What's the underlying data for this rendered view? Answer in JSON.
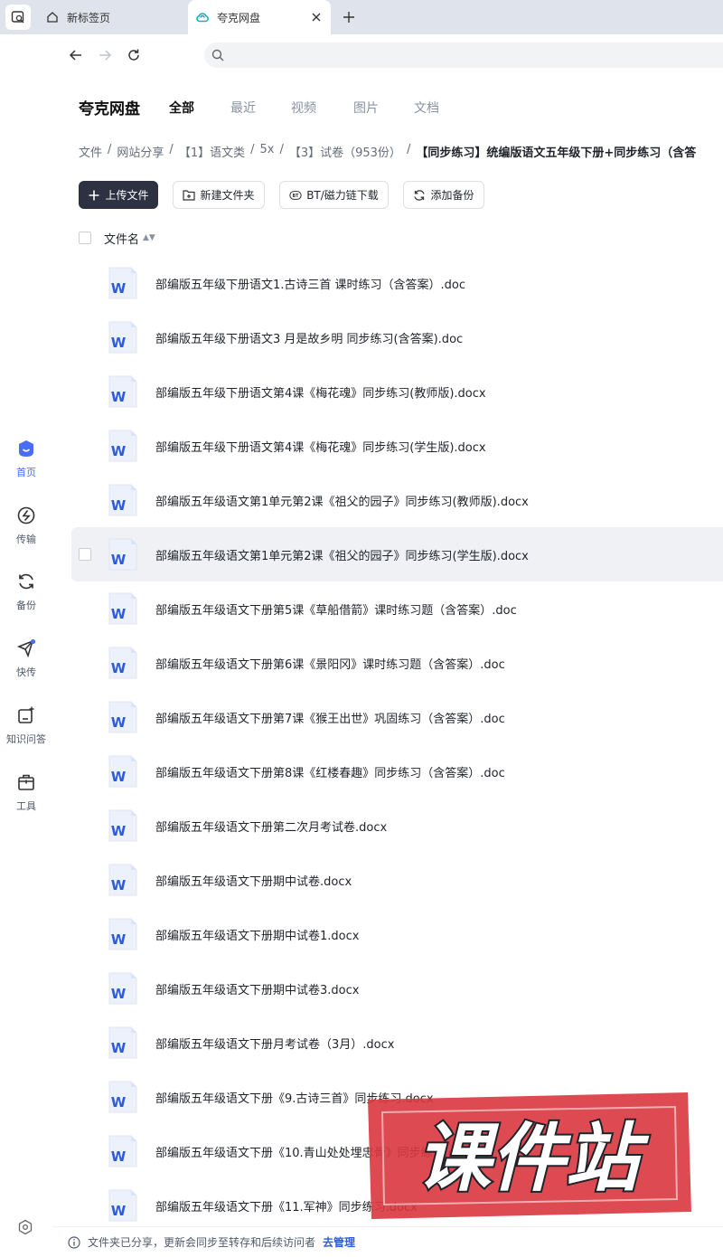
{
  "browser": {
    "tabs": [
      {
        "title": "新标签页"
      },
      {
        "title": "夸克网盘"
      }
    ],
    "address": {
      "value": "",
      "placeholder": ""
    }
  },
  "sidebar": {
    "items": [
      {
        "label": "首页",
        "icon": "home-robot-icon"
      },
      {
        "label": "传输",
        "icon": "transfer-icon"
      },
      {
        "label": "备份",
        "icon": "backup-sync-icon"
      },
      {
        "label": "快传",
        "icon": "paper-plane-icon"
      },
      {
        "label": "知识问答",
        "icon": "knowledge-qa-icon"
      },
      {
        "label": "工具",
        "icon": "toolbox-icon"
      }
    ]
  },
  "header": {
    "brand": "夸克网盘",
    "tabs": [
      "全部",
      "最近",
      "视频",
      "图片",
      "文档"
    ]
  },
  "breadcrumb": [
    "文件",
    "网站分享",
    "【1】语文类",
    "5x",
    "【3】试卷（953份）",
    "【同步练习】统编版语文五年级下册+同步练习（含答"
  ],
  "actions": {
    "upload": "上传文件",
    "new_folder": "新建文件夹",
    "bt_download": "BT/磁力链下载",
    "add_backup": "添加备份"
  },
  "list": {
    "header": "文件名",
    "files": [
      "部编版五年级下册语文1.古诗三首 课时练习（含答案）.doc",
      "部编版五年级下册语文3 月是故乡明 同步练习(含答案).doc",
      "部编版五年级下册语文第4课《梅花魂》同步练习(教师版).docx",
      "部编版五年级下册语文第4课《梅花魂》同步练习(学生版).docx",
      "部编版五年级语文第1单元第2课《祖父的园子》同步练习(教师版).docx",
      "部编版五年级语文第1单元第2课《祖父的园子》同步练习(学生版).docx",
      "部编版五年级语文下册第5课《草船借箭》课时练习题（含答案）.doc",
      "部编版五年级语文下册第6课《景阳冈》课时练习题（含答案）.doc",
      "部编版五年级语文下册第7课《猴王出世》巩固练习（含答案）.doc",
      "部编版五年级语文下册第8课《红楼春趣》同步练习（含答案）.doc",
      "部编版五年级语文下册第二次月考试卷.docx",
      "部编版五年级语文下册期中试卷.docx",
      "部编版五年级语文下册期中试卷1.docx",
      "部编版五年级语文下册期中试卷3.docx",
      "部编版五年级语文下册月考试卷（3月）.docx",
      "部编版五年级语文下册《9.古诗三首》同步练习.docx",
      "部编版五年级语文下册《10.青山处处埋忠骨》同步练习.docx",
      "部编版五年级语文下册《11.军神》同步练习.docx"
    ]
  },
  "footer": {
    "text": "文件夹已分享，更新会同步至转存和后续访问者",
    "link": "去管理"
  },
  "watermark": {
    "text": "课件站"
  },
  "colors": {
    "accent": "#4a6cf7",
    "primary_button": "#2d3142",
    "word_blue": "#2b5cd9",
    "stamp_red": "#d9363e"
  }
}
